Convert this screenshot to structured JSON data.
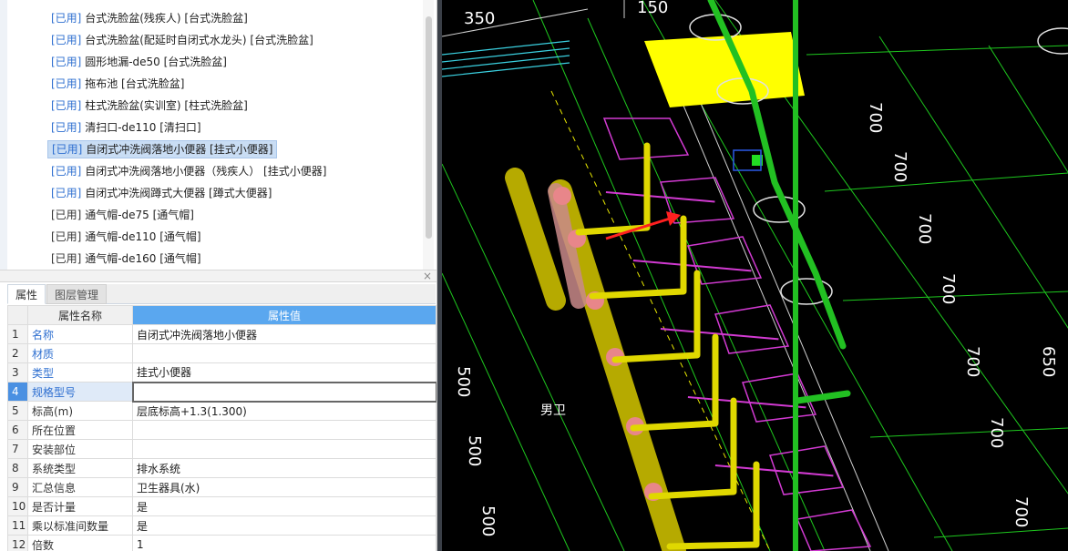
{
  "component_list": {
    "items": [
      {
        "tag": "[已用]",
        "text": "台式洗脸盆(残疾人) [台式洗脸盆]",
        "gray": false
      },
      {
        "tag": "[已用]",
        "text": "台式洗脸盆(配延时自闭式水龙头) [台式洗脸盆]",
        "gray": false
      },
      {
        "tag": "[已用]",
        "text": "圆形地漏-de50 [台式洗脸盆]",
        "gray": false
      },
      {
        "tag": "[已用]",
        "text": "拖布池 [台式洗脸盆]",
        "gray": false
      },
      {
        "tag": "[已用]",
        "text": "柱式洗脸盆(实训室) [柱式洗脸盆]",
        "gray": false
      },
      {
        "tag": "[已用]",
        "text": "清扫口-de110 [清扫口]",
        "gray": false
      },
      {
        "tag": "[已用]",
        "text": "自闭式冲洗阀落地小便器 [挂式小便器]",
        "gray": false,
        "selected": true
      },
      {
        "tag": "[已用]",
        "text": "自闭式冲洗阀落地小便器（残疾人） [挂式小便器]",
        "gray": false
      },
      {
        "tag": "[已用]",
        "text": "自闭式冲洗阀蹲式大便器 [蹲式大便器]",
        "gray": false
      },
      {
        "tag": "[已用]",
        "text": "通气帽-de75 [通气帽]",
        "gray": true
      },
      {
        "tag": "[已用]",
        "text": "通气帽-de110 [通气帽]",
        "gray": true
      },
      {
        "tag": "[已用]",
        "text": "通气帽-de160 [通气帽]",
        "gray": true
      }
    ]
  },
  "panel": {
    "close_glyph": "×",
    "tabs": [
      {
        "label": "属性",
        "active": true
      },
      {
        "label": "图层管理",
        "active": false
      }
    ]
  },
  "properties": {
    "header_name": "属性名称",
    "header_value": "属性值",
    "rows": [
      {
        "index": "1",
        "name": "名称",
        "value": "自闭式冲洗阀落地小便器",
        "blue": true
      },
      {
        "index": "2",
        "name": "材质",
        "value": "",
        "blue": true
      },
      {
        "index": "3",
        "name": "类型",
        "value": "挂式小便器",
        "blue": true
      },
      {
        "index": "4",
        "name": "规格型号",
        "value": "",
        "blue": true,
        "focus": true
      },
      {
        "index": "5",
        "name": "标高(m)",
        "value": "层底标高+1.3(1.300)",
        "blue": false
      },
      {
        "index": "6",
        "name": "所在位置",
        "value": "",
        "blue": false
      },
      {
        "index": "7",
        "name": "安装部位",
        "value": "",
        "blue": false
      },
      {
        "index": "8",
        "name": "系统类型",
        "value": "排水系统",
        "blue": false
      },
      {
        "index": "9",
        "name": "汇总信息",
        "value": "卫生器具(水)",
        "blue": false
      },
      {
        "index": "10",
        "name": "是否计量",
        "value": "是",
        "blue": false
      },
      {
        "index": "11",
        "name": "乘以标准间数量",
        "value": "是",
        "blue": false
      },
      {
        "index": "12",
        "name": "倍数",
        "value": "1",
        "blue": false
      }
    ]
  },
  "viewport": {
    "dimension_labels": [
      "350",
      "150",
      "700",
      "700",
      "700",
      "700",
      "700",
      "700",
      "700",
      "500",
      "500",
      "500",
      "650"
    ],
    "room_label": "男卫",
    "colors": {
      "background": "#000000",
      "drain_pipe": "#e0e000",
      "drain_pipe_joint": "#e8868a",
      "water_pipe": "#22c022",
      "fixture_outline": "#d23ad2",
      "grid_line": "#1ec81e",
      "highlight_box": "#ffff00",
      "arrow": "#ff2020",
      "dimension_text": "#ffffff"
    }
  }
}
